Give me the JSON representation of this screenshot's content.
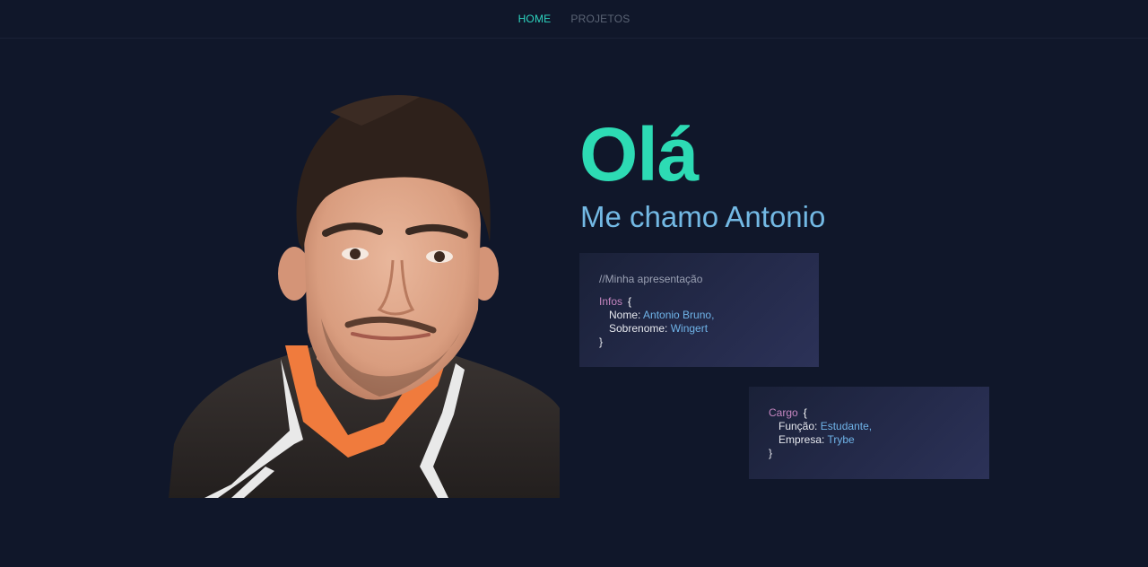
{
  "nav": {
    "home": "HOME",
    "projects": "PROJETOS"
  },
  "hero": {
    "greeting": "Olá",
    "intro": "Me chamo Antonio"
  },
  "card_infos": {
    "comment": "//Minha apresentação",
    "object": "Infos",
    "open": "{",
    "name_key": "Nome:",
    "name_value": "Antonio Bruno,",
    "surname_key": "Sobrenome:",
    "surname_value": "Wingert",
    "close": "}"
  },
  "card_cargo": {
    "object": "Cargo",
    "open": "{",
    "role_key": "Função:",
    "role_value": "Estudante,",
    "company_key": "Empresa:",
    "company_value": "Trybe",
    "close": "}"
  },
  "colors": {
    "background": "#10172a",
    "accent": "#2ddbb4",
    "intro": "#73b9e4",
    "keyword": "#c586c0",
    "value": "#6fb3e8"
  },
  "icons": {
    "portrait": "profile-photo"
  }
}
